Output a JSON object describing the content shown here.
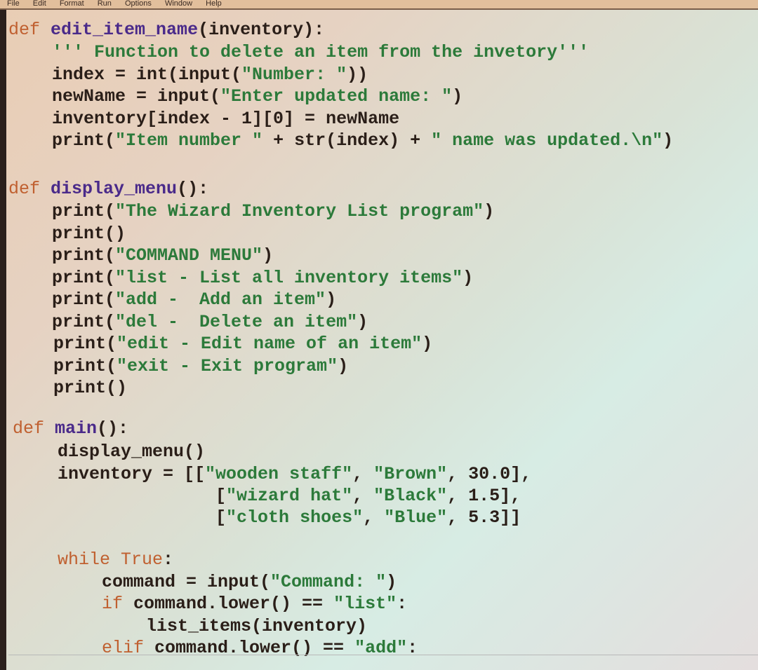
{
  "menubar": {
    "items": [
      "File",
      "Edit",
      "Format",
      "Run",
      "Options",
      "Window",
      "Help"
    ]
  },
  "code": {
    "edit_item_name": {
      "def_kw": "def",
      "name": "edit_item_name",
      "sig": "(inventory):",
      "docstring": "''' Function to delete an item from the invetory'''",
      "l1_a": "index = int(input(",
      "l1_s": "\"Number: \"",
      "l1_b": "))",
      "l2_a": "newName = input(",
      "l2_s": "\"Enter updated name: \"",
      "l2_b": ")",
      "l3": "inventory[index - 1][0] = newName",
      "l4_a": "print(",
      "l4_s1": "\"Item number \"",
      "l4_b": " + str(index) + ",
      "l4_s2": "\" name was updated.\\n\"",
      "l4_c": ")"
    },
    "display_menu": {
      "def_kw": "def",
      "name": "display_menu",
      "sig": "():",
      "lines": [
        {
          "pre": "print(",
          "str": "\"The Wizard Inventory List program\"",
          "post": ")"
        },
        {
          "pre": "print()",
          "str": "",
          "post": ""
        },
        {
          "pre": "print(",
          "str": "\"COMMAND MENU\"",
          "post": ")"
        },
        {
          "pre": "print(",
          "str": "\"list - List all inventory items\"",
          "post": ")"
        },
        {
          "pre": "print(",
          "str": "\"add -  Add an item\"",
          "post": ")"
        },
        {
          "pre": "print(",
          "str": "\"del -  Delete an item\"",
          "post": ")"
        },
        {
          "pre": "print(",
          "str": "\"edit - Edit name of an item\"",
          "post": ")"
        },
        {
          "pre": "print(",
          "str": "\"exit - Exit program\"",
          "post": ")"
        },
        {
          "pre": "print()",
          "str": "",
          "post": ""
        }
      ]
    },
    "main": {
      "def_kw": "def",
      "name": "main",
      "sig": "():",
      "l1": "display_menu()",
      "inv": [
        {
          "pre": "inventory = [[",
          "s1": "\"wooden staff\"",
          "mid": ", ",
          "s2": "\"Brown\"",
          "post": ", 30.0],"
        },
        {
          "pre": "               [",
          "s1": "\"wizard hat\"",
          "mid": ", ",
          "s2": "\"Black\"",
          "post": ", 1.5],"
        },
        {
          "pre": "               [",
          "s1": "\"cloth shoes\"",
          "mid": ", ",
          "s2": "\"Blue\"",
          "post": ", 5.3]]"
        }
      ],
      "while_kw": "while",
      "while_true": "True",
      "while_colon": ":",
      "cmd_a": "command = input(",
      "cmd_s": "\"Command: \"",
      "cmd_b": ")",
      "if_kw": "if",
      "if_a": " command.lower() == ",
      "if_s": "\"list\"",
      "if_b": ":",
      "list_call": "list_items(inventory)",
      "elif_kw": "elif",
      "elif_a": " command.lower() == ",
      "elif_s": "\"add\"",
      "elif_b": ":"
    }
  }
}
